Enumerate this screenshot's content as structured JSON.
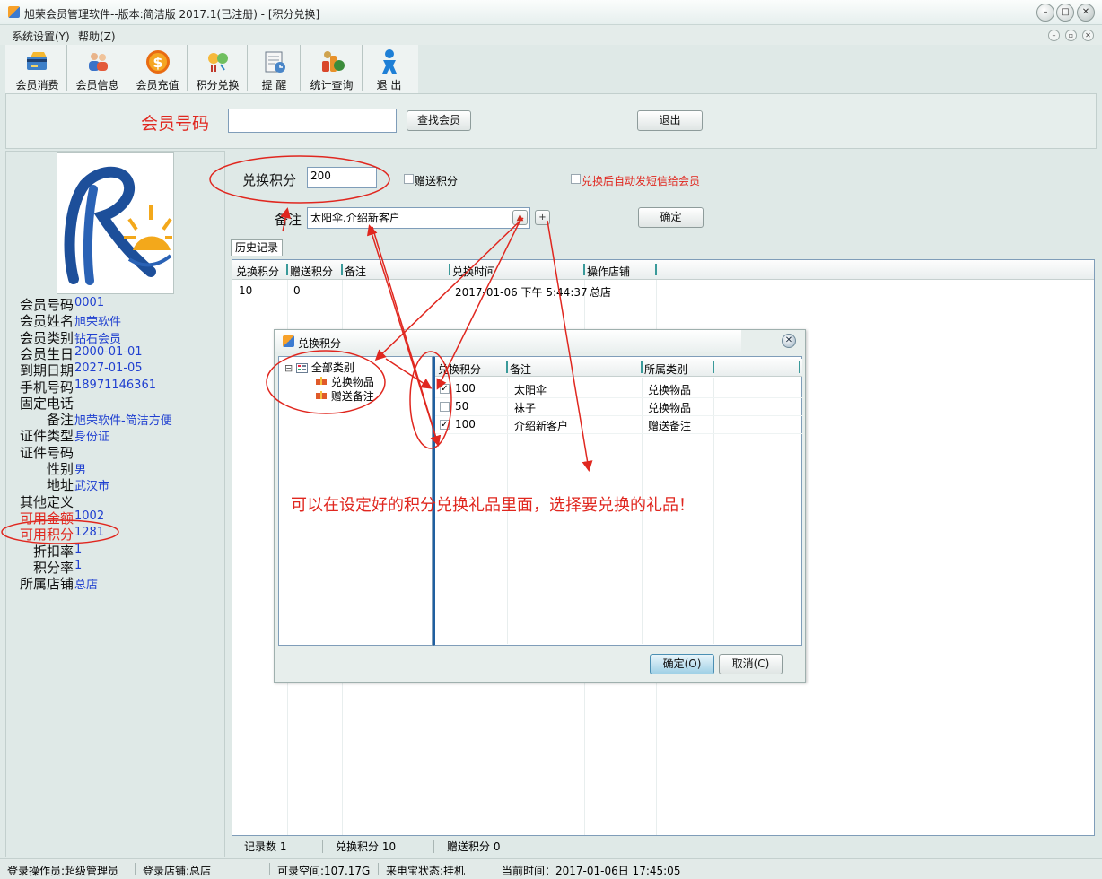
{
  "window": {
    "title": "旭荣会员管理软件--版本:简洁版 2017.1(已注册) - [积分兑换]",
    "min_glyph": "–",
    "max_glyph": "□",
    "close_glyph": "✕"
  },
  "menu": {
    "items": [
      "系统设置(Y)",
      "帮助(Z)"
    ],
    "mdi_glyphs": [
      "–",
      "▫",
      "✕"
    ]
  },
  "toolbar": {
    "buttons": [
      {
        "label": "会员消费",
        "icon": "card-payment-icon"
      },
      {
        "label": "会员信息",
        "icon": "members-icon"
      },
      {
        "label": "会员充值",
        "icon": "dollar-coin-icon"
      },
      {
        "label": "积分兑换",
        "icon": "points-exchange-icon"
      },
      {
        "label": "提 醒",
        "icon": "reminder-icon"
      },
      {
        "label": "统计查询",
        "icon": "statistics-icon"
      },
      {
        "label": "退 出",
        "icon": "exit-person-icon"
      }
    ]
  },
  "search": {
    "member_no_label": "会员号码",
    "member_no_value": "",
    "find_button": "查找会员",
    "exit_button": "退出"
  },
  "member_info": {
    "rows": [
      {
        "label": "会员号码",
        "value": "0001"
      },
      {
        "label": "会员姓名",
        "value": "旭荣软件"
      },
      {
        "label": "会员类别",
        "value": "钻石会员"
      },
      {
        "label": "会员生日",
        "value": "2000-01-01"
      },
      {
        "label": "到期日期",
        "value": "2027-01-05"
      },
      {
        "label": "手机号码",
        "value": "18971146361"
      },
      {
        "label": "固定电话",
        "value": ""
      },
      {
        "label": "备注",
        "value": "旭荣软件-简洁方便"
      },
      {
        "label": "证件类型",
        "value": "身份证"
      },
      {
        "label": "证件号码",
        "value": ""
      },
      {
        "label": "性别",
        "value": "男"
      },
      {
        "label": "地址",
        "value": "武汉市"
      },
      {
        "label": "其他定义",
        "value": ""
      },
      {
        "label": "可用金额",
        "value": "1002"
      },
      {
        "label": "可用积分",
        "value": "1281"
      },
      {
        "label": "折扣率",
        "value": "1"
      },
      {
        "label": "积分率",
        "value": "1"
      },
      {
        "label": "所属店铺",
        "value": "总店"
      }
    ]
  },
  "exchange_form": {
    "points_label": "兑换积分",
    "points_value": "200",
    "gift_points_label": "赠送积分",
    "sms_label": "兑换后自动发短信给会员",
    "remark_label": "备注",
    "remark_value": "太阳伞.介绍新客户",
    "remark_pick_glyph": "▲",
    "remark_add_glyph": "+",
    "confirm_button": "确定"
  },
  "history": {
    "tab_label": "历史记录",
    "columns": [
      "兑换积分",
      "赠送积分",
      "备注",
      "兑换时间",
      "操作店铺"
    ],
    "rows": [
      {
        "points": "10",
        "gift": "0",
        "remark": "",
        "time": "2017-01-06 下午 5:44:37",
        "store": "总店"
      }
    ],
    "status": {
      "record_count": "记录数 1",
      "points_total": "兑换积分 10",
      "gift_total": "赠送积分 0"
    }
  },
  "dialog": {
    "title": "兑换积分",
    "close_glyph": "✕",
    "tree": {
      "root": "全部类别",
      "root_toggle": "⊟",
      "children": [
        "兑换物品",
        "赠送备注"
      ]
    },
    "columns": [
      "兑换积分",
      "备注",
      "所属类别"
    ],
    "rows": [
      {
        "checked": true,
        "points": "100",
        "remark": "太阳伞",
        "category": "兑换物品"
      },
      {
        "checked": false,
        "points": "50",
        "remark": "袜子",
        "category": "兑换物品"
      },
      {
        "checked": true,
        "points": "100",
        "remark": "介绍新客户",
        "category": "赠送备注"
      }
    ],
    "ok_button": "确定(O)",
    "cancel_button": "取消(C)"
  },
  "annotation": {
    "text": "可以在设定好的积分兑换礼品里面，选择要兑换的礼品！",
    "color": "#e0271f"
  },
  "status_bar": {
    "operator": "登录操作员:超级管理员",
    "store": "登录店铺:总店",
    "disk": "可录空间:107.17G",
    "caller": "来电宝状态:挂机",
    "time": "当前时间：2017-01-06日 17:45:05"
  },
  "colors": {
    "accent_red": "#e0271f",
    "value_blue": "#1f3fd0",
    "panel_bg": "#dfe9e7"
  }
}
